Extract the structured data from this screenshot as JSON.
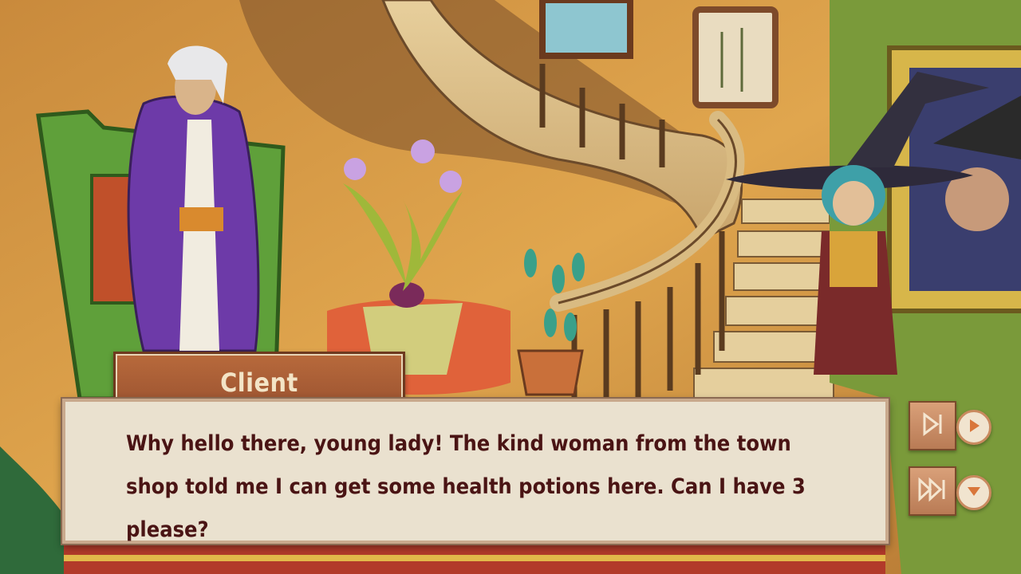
{
  "dialogue": {
    "speaker": "Client",
    "line": "Why hello there, young lady! The kind woman from the town shop told me I can get some health potions here. Can I have 3 please?"
  },
  "controls": {
    "step_icon": "skip-next-icon",
    "fast_forward_icon": "fast-forward-icon",
    "play_icon": "play-icon",
    "hide_icon": "arrow-down-icon"
  },
  "colors": {
    "text": "#4a1414",
    "panel": "#eae1cf",
    "accent": "#b97b55"
  }
}
